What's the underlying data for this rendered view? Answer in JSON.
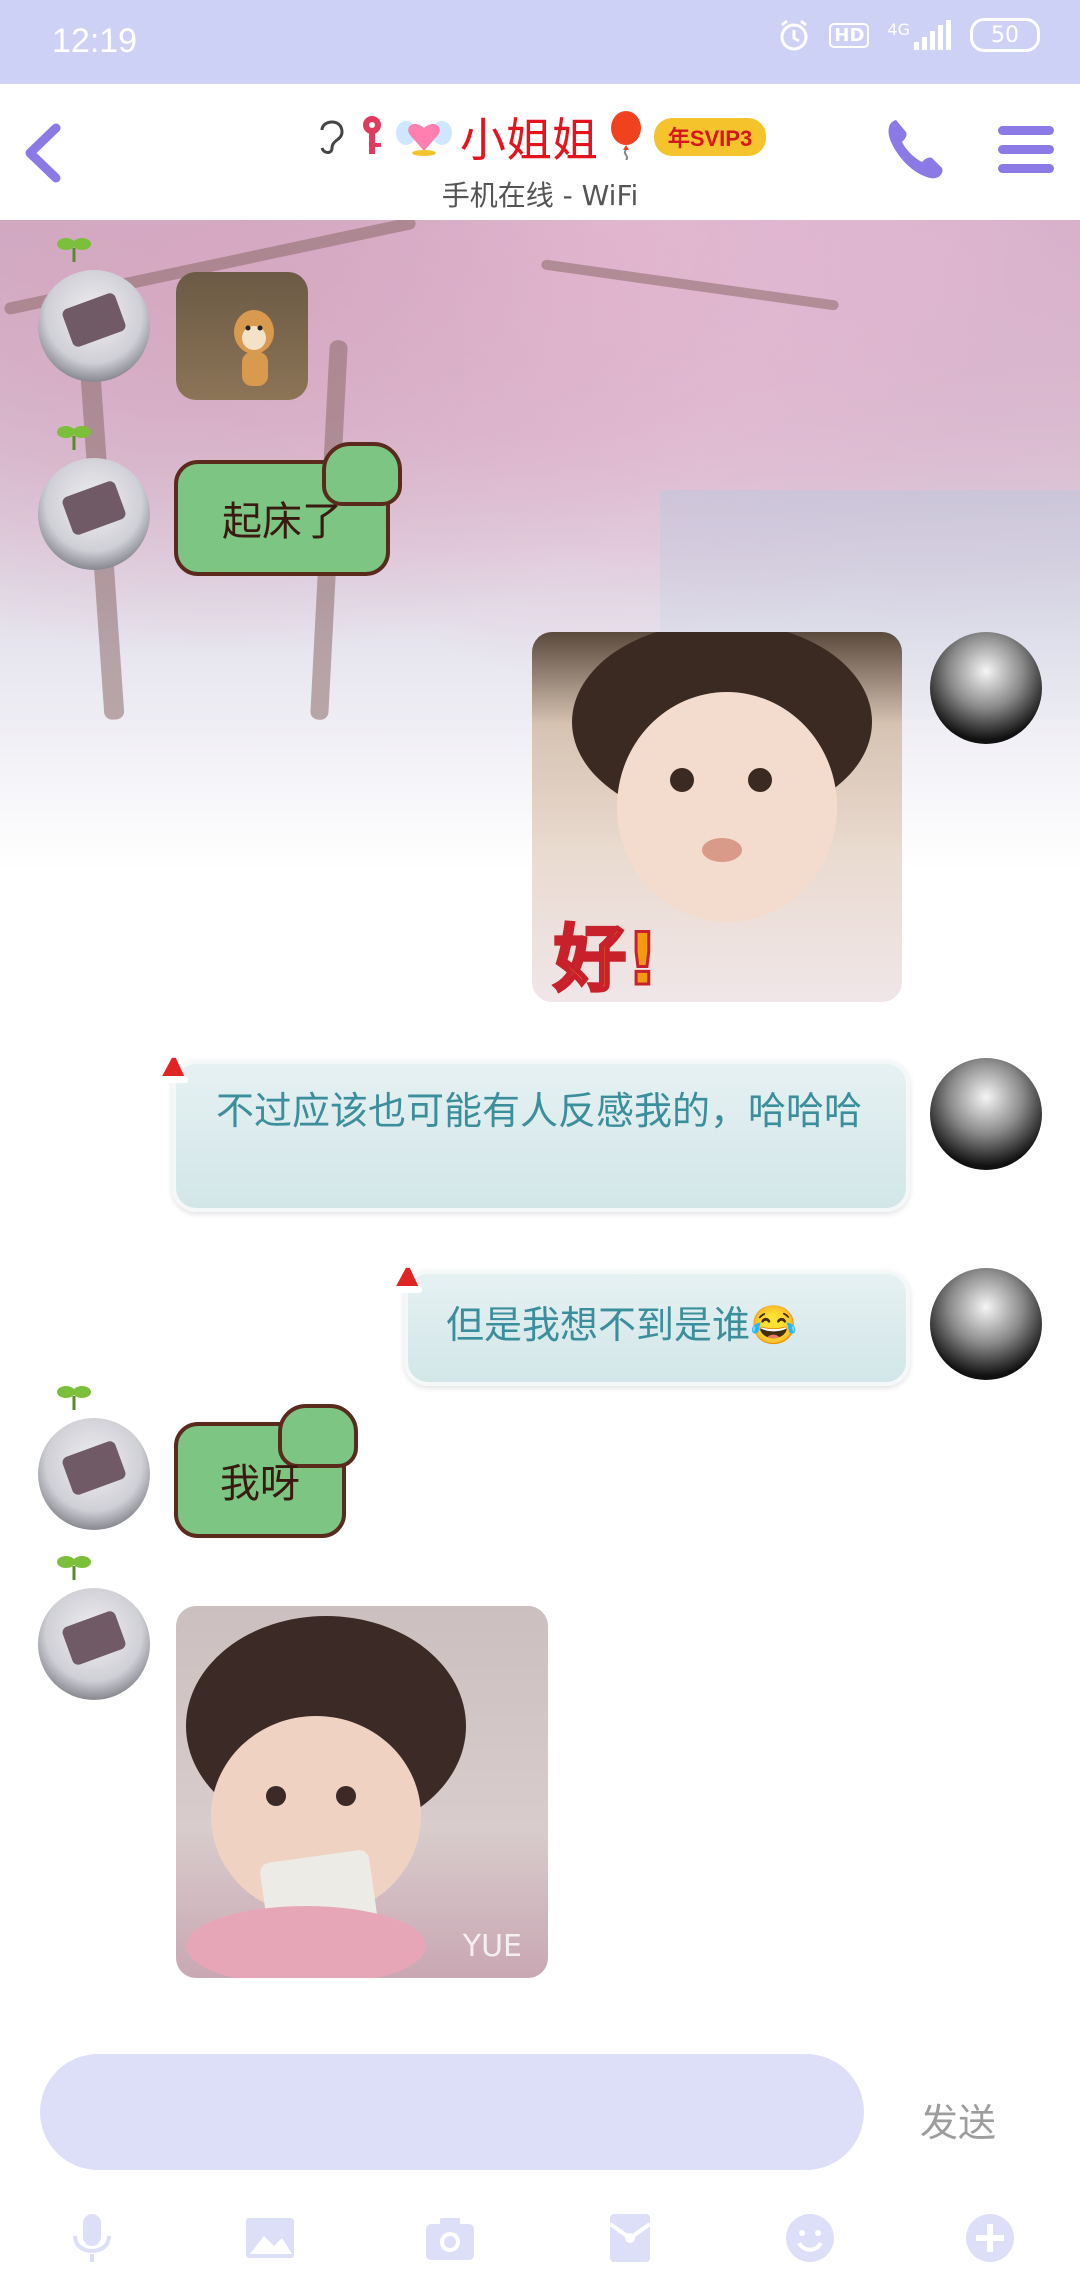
{
  "status_bar": {
    "time": "12:19",
    "hd": "HD",
    "network": "4G",
    "battery": "50"
  },
  "header": {
    "contact_name": "小姐姐",
    "badge": "年SVIP3",
    "subtitle": "手机在线 - WiFi",
    "accent_color": "#8b79e6",
    "name_color": "#e4131c"
  },
  "messages": [
    {
      "side": "left",
      "type": "image",
      "desc_icon": "shiba-dog-sticker"
    },
    {
      "side": "left",
      "type": "text",
      "text": "起床了"
    },
    {
      "side": "right",
      "type": "image",
      "caption": "好!"
    },
    {
      "side": "right",
      "type": "text",
      "text": "不过应该也可能有人反感我的，哈哈哈"
    },
    {
      "side": "right",
      "type": "text",
      "text": "但是我想不到是谁😂"
    },
    {
      "side": "left",
      "type": "text",
      "text": "我呀"
    },
    {
      "side": "left",
      "type": "image",
      "watermark": "YUE"
    }
  ],
  "composer": {
    "send_label": "发送",
    "input_value": ""
  },
  "toolbar": {
    "icons": [
      "microphone-icon",
      "image-icon",
      "camera-icon",
      "red-packet-icon",
      "emoji-icon",
      "plus-icon"
    ]
  }
}
